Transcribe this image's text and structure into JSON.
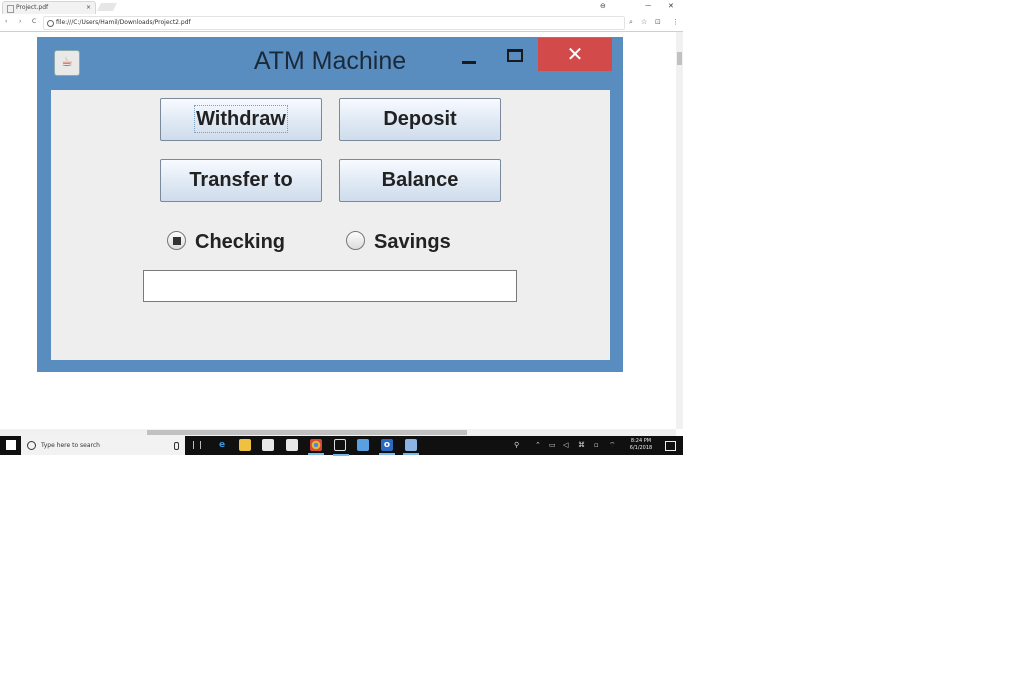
{
  "browser": {
    "tab_title": "Project.pdf",
    "tab_close": "×",
    "url": "file:///C:/Users/Hamil/Downloads/Project2.pdf",
    "back": "‹",
    "forward": "›",
    "reload": "C",
    "window_controls": {
      "account": "⊖",
      "minimize": "ᅳ",
      "close": "✕"
    },
    "toolbar_icons": {
      "zoom": "⌕",
      "bookmark": "☆",
      "cast": "⊡",
      "menu": "⋮"
    }
  },
  "atm": {
    "title": "ATM Machine",
    "close_label": "✕",
    "java_icon": "☕",
    "buttons": {
      "withdraw": "Withdraw",
      "deposit": "Deposit",
      "transfer": "Transfer to",
      "balance": "Balance"
    },
    "accounts": [
      {
        "label": "Checking",
        "selected": true
      },
      {
        "label": "Savings",
        "selected": false
      }
    ],
    "amount_value": ""
  },
  "taskbar": {
    "search_placeholder": "Type here to search",
    "apps": [
      "edge-icon",
      "file-explorer-icon",
      "store-icon",
      "mail-icon",
      "chrome-icon",
      "app-icon",
      "virtualbox-icon",
      "outlook-icon",
      "box-icon"
    ],
    "edge_glyph": "e",
    "outlook_glyph": "o",
    "clock_time": "8:24 PM",
    "clock_date": "6/1/2018"
  }
}
